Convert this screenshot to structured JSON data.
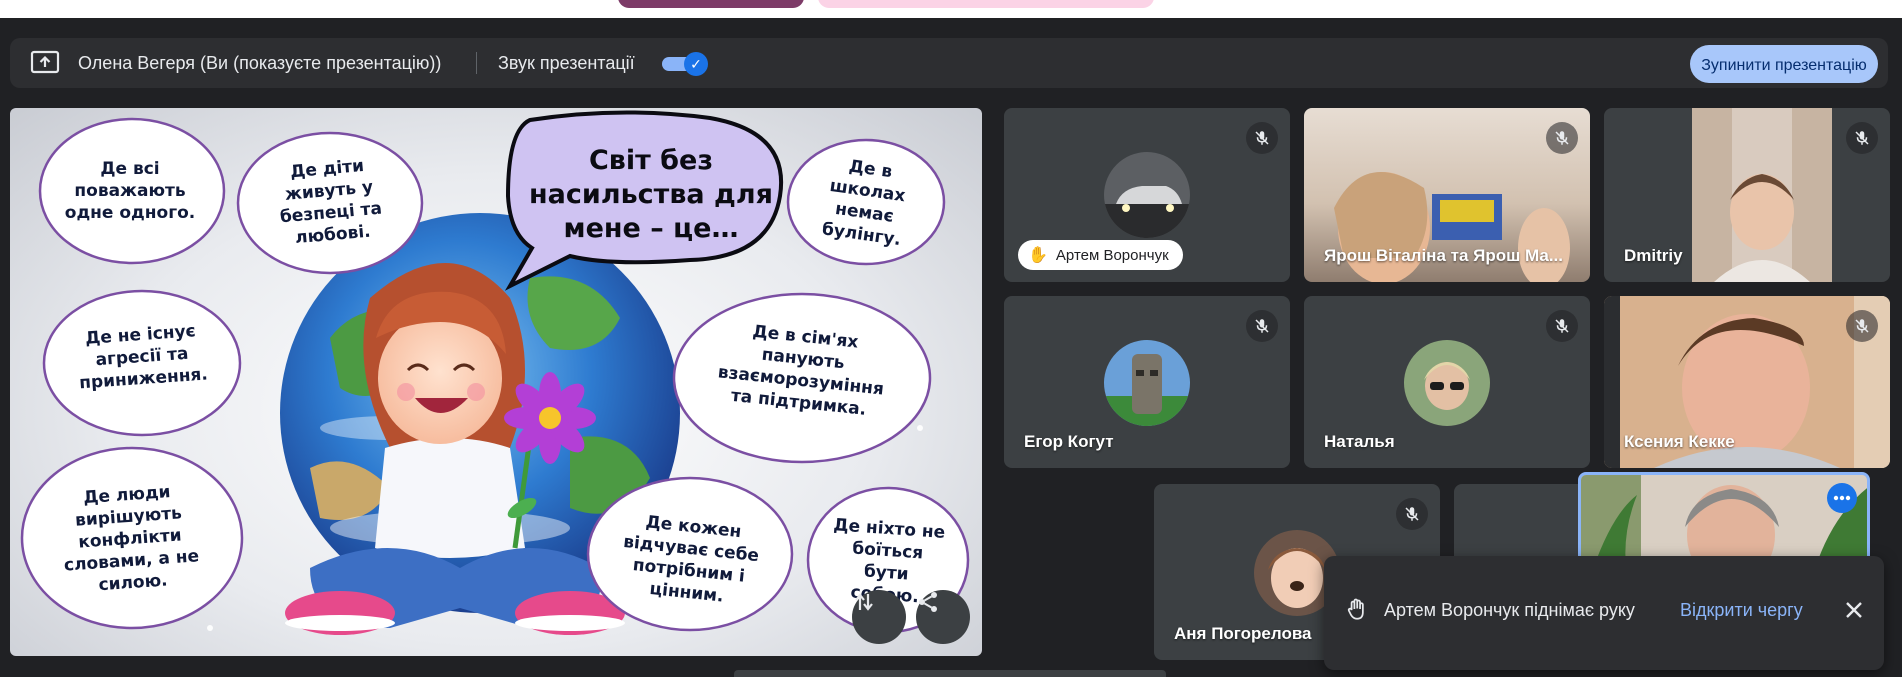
{
  "presenting_bar": {
    "presenter_label": "Олена Вегеря (Ви (показуєте презентацію))",
    "sound_label": "Звук презентації",
    "sound_enabled": true,
    "stop_button_label": "Зупинити презентацію"
  },
  "slide": {
    "speech_bubble": "Світ без насильства для мене – це…",
    "clouds": [
      "Де всі поважають одне одного.",
      "Де діти живуть у безпеці та любові.",
      "Де в школах немає булінгу.",
      "Де не існує агресії та приниження.",
      "Де в сім'ях панують взаєморозуміння та підтримка.",
      "Де люди вирішують конфлікти словами, а не силою.",
      "Де кожен відчуває себе потрібним і цінним.",
      "Де ніхто не боїться бути собою."
    ]
  },
  "participants": [
    {
      "name": "Артем Ворончук",
      "hand_raised": true,
      "muted": true
    },
    {
      "name": "Ярош Віталіна та Ярош Ма...",
      "muted": true
    },
    {
      "name": "Dmitriy",
      "muted": true
    },
    {
      "name": "Егор Когут",
      "muted": true
    },
    {
      "name": "Наталья",
      "muted": true
    },
    {
      "name": "Ксения Кекке",
      "muted": true
    },
    {
      "name": "Аня Погорелова",
      "muted": true
    }
  ],
  "toast": {
    "message": "Артем Ворончук піднімає руку",
    "action_label": "Відкрити чергу"
  },
  "colors": {
    "background": "#202124",
    "tile": "#3c4043",
    "accent": "#8ab4f8",
    "stop_button": "#a8c7fa",
    "cloud_outline": "#7b4fa3",
    "speech_fill": "#cfc3f2"
  }
}
